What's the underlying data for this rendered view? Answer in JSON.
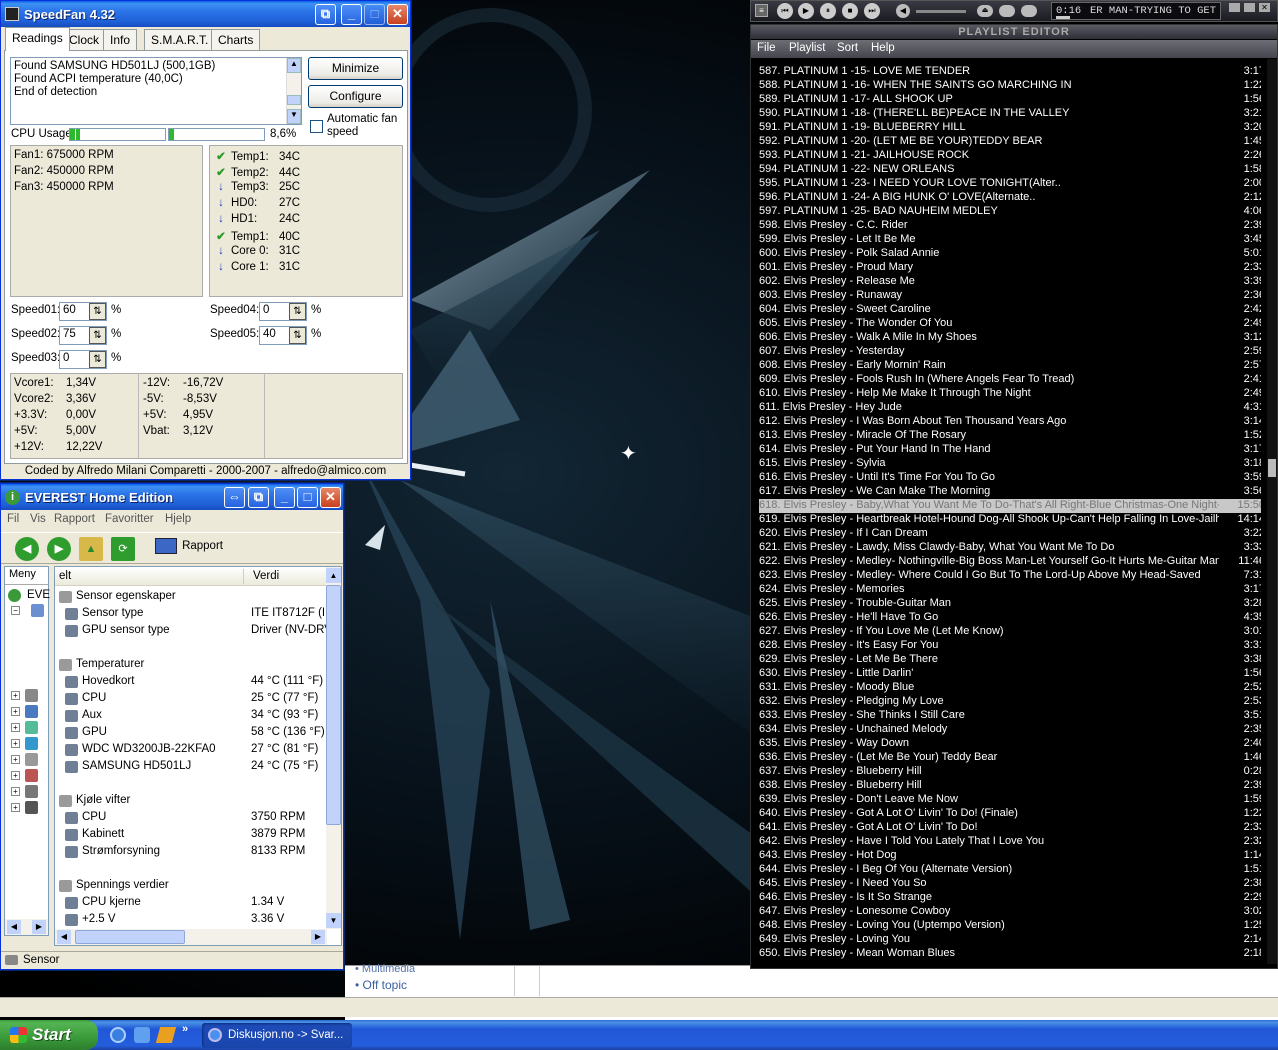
{
  "speedfan": {
    "title": "SpeedFan 4.32",
    "tabs": [
      "Readings",
      "Clock",
      "Info",
      "S.M.A.R.T.",
      "Charts"
    ],
    "log": [
      "Found SAMSUNG HD501LJ (500,1GB)",
      "Found ACPI temperature (40,0C)",
      "End of detection"
    ],
    "btn_minimize": "Minimize",
    "btn_configure": "Configure",
    "auto_fan": "Automatic fan speed",
    "cpu_usage_label": "CPU Usage",
    "cpu_usage_value": "8,6%",
    "cpu_bar1_fill": 0.1,
    "cpu_bar2_fill": 0.06,
    "fans": [
      "Fan1: 675000 RPM",
      "Fan2: 450000 RPM",
      "Fan3: 450000 RPM"
    ],
    "temps": [
      {
        "label": "Temp1:",
        "value": "34C",
        "icon": "check"
      },
      {
        "label": "Temp2:",
        "value": "44C",
        "icon": "check"
      },
      {
        "label": "Temp3:",
        "value": "25C",
        "icon": "arrow-down"
      },
      {
        "label": "HD0:",
        "value": "27C",
        "icon": "arrow-down"
      },
      {
        "label": "HD1:",
        "value": "24C",
        "icon": "arrow-down"
      },
      {
        "label": "Temp1:",
        "value": "40C",
        "icon": "check"
      },
      {
        "label": "Core 0:",
        "value": "31C",
        "icon": "arrow-down"
      },
      {
        "label": "Core 1:",
        "value": "31C",
        "icon": "arrow-down"
      }
    ],
    "speeds": [
      {
        "label": "Speed01:",
        "value": "60"
      },
      {
        "label": "Speed02:",
        "value": "75"
      },
      {
        "label": "Speed03:",
        "value": "0"
      },
      {
        "label": "Speed04:",
        "value": "0"
      },
      {
        "label": "Speed05:",
        "value": "40"
      }
    ],
    "pct": "%",
    "volts_left": [
      [
        "Vcore1:",
        "1,34V"
      ],
      [
        "Vcore2:",
        "3,36V"
      ],
      [
        "+3.3V:",
        "0,00V"
      ],
      [
        "+5V:",
        "5,00V"
      ],
      [
        "+12V:",
        "12,22V"
      ]
    ],
    "volts_right": [
      [
        "-12V:",
        "-16,72V"
      ],
      [
        "-5V:",
        "-8,53V"
      ],
      [
        "+5V:",
        "4,95V"
      ],
      [
        "Vbat:",
        "3,12V"
      ]
    ],
    "footer": "Coded by Alfredo Milani Comparetti - 2000-2007 - alfredo@almico.com"
  },
  "everest": {
    "title": "EVEREST Home Edition",
    "menu": [
      "Fil",
      "Vis",
      "Rapport",
      "Favoritter",
      "Hjelp"
    ],
    "toolbar_rapport": "Rapport",
    "tree_tab": "Meny",
    "tree_root": "EVE",
    "col_felt": "elt",
    "col_verdi": "Verdi",
    "rows": [
      {
        "kind": "head",
        "icon": "sensor-icon",
        "felt": "Sensor egenskaper",
        "verdi": ""
      },
      {
        "kind": "item",
        "icon": "chip-icon",
        "felt": "Sensor type",
        "verdi": "ITE IT8712F  (I:"
      },
      {
        "kind": "item",
        "icon": "gpu-icon",
        "felt": "GPU sensor type",
        "verdi": "Driver  (NV-DRV"
      },
      {
        "kind": "gap"
      },
      {
        "kind": "head",
        "icon": "thermo-icon",
        "felt": "Temperaturer",
        "verdi": ""
      },
      {
        "kind": "item",
        "icon": "board-icon",
        "felt": "Hovedkort",
        "verdi": "44 °C  (111 °F)"
      },
      {
        "kind": "item",
        "icon": "cpu-icon",
        "felt": "CPU",
        "verdi": "25 °C  (77 °F)"
      },
      {
        "kind": "item",
        "icon": "aux-icon",
        "felt": "Aux",
        "verdi": "34 °C  (93 °F)"
      },
      {
        "kind": "item",
        "icon": "gpu-icon",
        "felt": "GPU",
        "verdi": "58 °C  (136 °F)"
      },
      {
        "kind": "item",
        "icon": "disk-icon",
        "felt": "WDC WD3200JB-22KFA0",
        "verdi": "27 °C  (81 °F)"
      },
      {
        "kind": "item",
        "icon": "disk-icon",
        "felt": "SAMSUNG HD501LJ",
        "verdi": "24 °C  (75 °F)"
      },
      {
        "kind": "gap"
      },
      {
        "kind": "head",
        "icon": "fan-icon",
        "felt": "Kjøle vifter",
        "verdi": ""
      },
      {
        "kind": "item",
        "icon": "cpu-icon",
        "felt": "CPU",
        "verdi": "3750 RPM"
      },
      {
        "kind": "item",
        "icon": "case-icon",
        "felt": "Kabinett",
        "verdi": "3879 RPM"
      },
      {
        "kind": "item",
        "icon": "psu-icon",
        "felt": "Strømforsyning",
        "verdi": "8133 RPM"
      },
      {
        "kind": "gap"
      },
      {
        "kind": "head",
        "icon": "volt-icon",
        "felt": "Spennings verdier",
        "verdi": ""
      },
      {
        "kind": "item",
        "icon": "cpu-icon",
        "felt": "CPU kjerne",
        "verdi": "1.34 V"
      },
      {
        "kind": "item",
        "icon": "cpu-icon",
        "felt": "+2.5 V",
        "verdi": "3.36 V"
      }
    ],
    "status": "Sensor"
  },
  "browser_bg": {
    "link1": "Multimedia",
    "link2": "Off topic"
  },
  "winamp": {
    "time": "0:16",
    "ticker": "ER MAN-TRYING TO GET",
    "pl_title": "PLAYLIST EDITOR",
    "pl_menu": [
      "File",
      "Playlist",
      "Sort",
      "Help"
    ],
    "selected_index": 31,
    "tracks": [
      [
        "587. PLATINUM 1 -15- LOVE ME TENDER",
        "3:17"
      ],
      [
        "588. PLATINUM 1 -16- WHEN THE SAINTS GO MARCHING IN",
        "1:22"
      ],
      [
        "589. PLATINUM 1 -17- ALL SHOOK UP",
        "1:56"
      ],
      [
        "590. PLATINUM 1 -18- (THERE'LL BE)PEACE IN THE VALLEY",
        "3:21"
      ],
      [
        "591. PLATINUM 1 -19- BLUEBERRY HILL",
        "3:20"
      ],
      [
        "592. PLATINUM 1 -20- (LET ME BE YOUR)TEDDY BEAR",
        "1:45"
      ],
      [
        "593. PLATINUM 1 -21- JAILHOUSE ROCK",
        "2:26"
      ],
      [
        "594. PLATINUM 1 -22- NEW ORLEANS",
        "1:58"
      ],
      [
        "595. PLATINUM 1 -23- I NEED YOUR LOVE TONIGHT(Alter..",
        "2:00"
      ],
      [
        "596. PLATINUM 1 -24- A BIG HUNK O' LOVE(Alternate..",
        "2:12"
      ],
      [
        "597. PLATINUM 1 -25- BAD NAUHEIM MEDLEY",
        "4:06"
      ],
      [
        "598. Elvis Presley - C.C. Rider",
        "2:39"
      ],
      [
        "599. Elvis Presley - Let It Be Me",
        "3:45"
      ],
      [
        "600. Elvis Presley - Polk Salad Annie",
        "5:01"
      ],
      [
        "601. Elvis Presley - Proud Mary",
        "2:33"
      ],
      [
        "602. Elvis Presley - Release Me",
        "3:39"
      ],
      [
        "603. Elvis Presley - Runaway",
        "2:36"
      ],
      [
        "604. Elvis Presley - Sweet Caroline",
        "2:42"
      ],
      [
        "605. Elvis Presley - The Wonder Of You",
        "2:49"
      ],
      [
        "606. Elvis Presley - Walk A Mile In My Shoes",
        "3:12"
      ],
      [
        "607. Elvis Presley - Yesterday",
        "2:59"
      ],
      [
        "608. Elvis Presley - Early Mornin' Rain",
        "2:57"
      ],
      [
        "609. Elvis Presley - Fools Rush In (Where Angels Fear To Tread)",
        "2:41"
      ],
      [
        "610. Elvis Presley - Help Me Make It Through The Night",
        "2:49"
      ],
      [
        "611. Elvis Presley - Hey Jude",
        "4:31"
      ],
      [
        "612. Elvis Presley - I Was Born About Ten Thousand Years Ago",
        "3:14"
      ],
      [
        "613. Elvis Presley - Miracle Of The Rosary",
        "1:52"
      ],
      [
        "614. Elvis Presley - Put Your Hand In The Hand",
        "3:17"
      ],
      [
        "615. Elvis Presley - Sylvia",
        "3:18"
      ],
      [
        "616. Elvis Presley - Until It's Time For You To Go",
        "3:59"
      ],
      [
        "617. Elvis Presley - We Can Make The Morning",
        "3:56"
      ],
      [
        "618. Elvis Presley - Baby,What You Want Me To Do-That's All Right-Blue Christmas-One Night-",
        "15:50"
      ],
      [
        "619. Elvis Presley - Heartbreak Hotel-Hound Dog-All Shook Up-Can't Help Falling In Love-Jailho...",
        "14:14"
      ],
      [
        "620. Elvis Presley - If I Can Dream",
        "3:22"
      ],
      [
        "621. Elvis Presley - Lawdy, Miss Clawdy-Baby, What You Want Me To Do",
        "3:33"
      ],
      [
        "622. Elvis Presley - Medley- Nothingville-Big Boss Man-Let Yourself Go-It Hurts Me-Guitar Man...",
        "11:46"
      ],
      [
        "623. Elvis Presley - Medley- Where Could I Go But To The Lord-Up Above My Head-Saved",
        "7:31"
      ],
      [
        "624. Elvis Presley - Memories",
        "3:17"
      ],
      [
        "625. Elvis Presley - Trouble-Guitar Man",
        "3:28"
      ],
      [
        "626. Elvis Presley - He'll Have To Go",
        "4:35"
      ],
      [
        "627. Elvis Presley - If You Love Me (Let Me Know)",
        "3:01"
      ],
      [
        "628. Elvis Presley - It's Easy For You",
        "3:31"
      ],
      [
        "629. Elvis Presley - Let Me Be There",
        "3:38"
      ],
      [
        "630. Elvis Presley - Little Darlin'",
        "1:56"
      ],
      [
        "631. Elvis Presley - Moody Blue",
        "2:52"
      ],
      [
        "632. Elvis Presley - Pledging My Love",
        "2:53"
      ],
      [
        "633. Elvis Presley - She Thinks I Still Care",
        "3:51"
      ],
      [
        "634. Elvis Presley - Unchained Melody",
        "2:35"
      ],
      [
        "635. Elvis Presley - Way Down",
        "2:40"
      ],
      [
        "636. Elvis Presley - (Let Me Be Your) Teddy Bear",
        "1:46"
      ],
      [
        "637. Elvis Presley - Blueberry Hill",
        "0:28"
      ],
      [
        "638. Elvis Presley - Blueberry Hill",
        "2:39"
      ],
      [
        "639. Elvis Presley - Don't Leave Me Now",
        "1:59"
      ],
      [
        "640. Elvis Presley - Got A Lot O' Livin' To Do! (Finale)",
        "1:22"
      ],
      [
        "641. Elvis Presley - Got A Lot O' Livin' To Do!",
        "2:33"
      ],
      [
        "642. Elvis Presley - Have I Told You Lately That I Love You",
        "2:32"
      ],
      [
        "643. Elvis Presley - Hot Dog",
        "1:14"
      ],
      [
        "644. Elvis Presley - I Beg Of You (Alternate Version)",
        "1:51"
      ],
      [
        "645. Elvis Presley - I Need You So",
        "2:38"
      ],
      [
        "646. Elvis Presley - Is It So Strange",
        "2:29"
      ],
      [
        "647. Elvis Presley - Lonesome Cowboy",
        "3:02"
      ],
      [
        "648. Elvis Presley - Loving You (Uptempo Version)",
        "1:25"
      ],
      [
        "649. Elvis Presley - Loving You",
        "2:14"
      ],
      [
        "650. Elvis Presley - Mean Woman Blues",
        "2:18"
      ]
    ]
  },
  "taskbar": {
    "start": "Start",
    "task": "Diskusjon.no -> Svar..."
  }
}
